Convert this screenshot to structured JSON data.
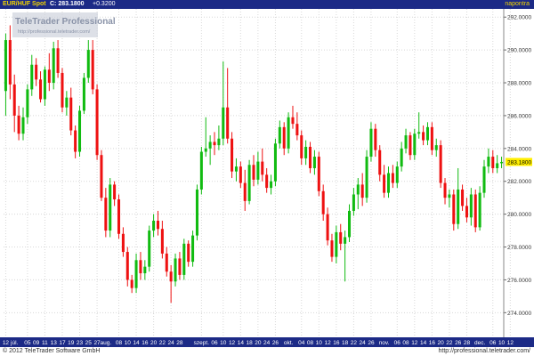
{
  "header": {
    "symbol": "EUR/HUF Spot",
    "close_label": "C: 283.1800",
    "change_label": "+0.3200",
    "period_label": "napontra"
  },
  "watermark": {
    "brand": "TeleTrader Professional",
    "url": "http://professional.teletrader.com/"
  },
  "footer": {
    "copyright": "© 2012 TeleTrader Software GmbH",
    "url": "http://professional.teletrader.com/"
  },
  "colors": {
    "up": "#11bb11",
    "down": "#ee1111",
    "header_bg": "#1c2a86",
    "accent": "#f2d400",
    "grid": "#d8d8d8",
    "last_price_bg": "#ffee00"
  },
  "chart_data": {
    "type": "candlestick",
    "ylim": [
      272.5,
      292.5
    ],
    "yticks": [
      274,
      276,
      278,
      280,
      282,
      284,
      286,
      288,
      290,
      292
    ],
    "ytick_labels": [
      "274.0000",
      "276.0000",
      "278.0000",
      "280.0000",
      "282.0000",
      "284.0000",
      "286.0000",
      "288.0000",
      "290.0000",
      "292.0000"
    ],
    "last_price": 283.18,
    "last_price_label": "283.1800",
    "grid": true,
    "x_labels": [
      {
        "text": "12",
        "index": 0
      },
      {
        "text": "júl.",
        "index": 2
      },
      {
        "text": "05",
        "index": 5
      },
      {
        "text": "09",
        "index": 7
      },
      {
        "text": "11",
        "index": 9
      },
      {
        "text": "13",
        "index": 11
      },
      {
        "text": "17",
        "index": 13
      },
      {
        "text": "19",
        "index": 15
      },
      {
        "text": "23",
        "index": 17
      },
      {
        "text": "25",
        "index": 19
      },
      {
        "text": "27",
        "index": 21
      },
      {
        "text": "aug.",
        "index": 23
      },
      {
        "text": "08",
        "index": 26
      },
      {
        "text": "10",
        "index": 28
      },
      {
        "text": "14",
        "index": 30
      },
      {
        "text": "16",
        "index": 32
      },
      {
        "text": "20",
        "index": 34
      },
      {
        "text": "22",
        "index": 36
      },
      {
        "text": "24",
        "index": 38
      },
      {
        "text": "28",
        "index": 40
      },
      {
        "text": "szept.",
        "index": 45
      },
      {
        "text": "06",
        "index": 48
      },
      {
        "text": "10",
        "index": 50
      },
      {
        "text": "12",
        "index": 52
      },
      {
        "text": "14",
        "index": 54
      },
      {
        "text": "18",
        "index": 56
      },
      {
        "text": "20",
        "index": 58
      },
      {
        "text": "24",
        "index": 60
      },
      {
        "text": "26",
        "index": 62
      },
      {
        "text": "okt.",
        "index": 65
      },
      {
        "text": "04",
        "index": 68
      },
      {
        "text": "08",
        "index": 70
      },
      {
        "text": "10",
        "index": 72
      },
      {
        "text": "12",
        "index": 74
      },
      {
        "text": "16",
        "index": 76
      },
      {
        "text": "18",
        "index": 78
      },
      {
        "text": "22",
        "index": 80
      },
      {
        "text": "24",
        "index": 82
      },
      {
        "text": "26",
        "index": 84
      },
      {
        "text": "nov.",
        "index": 87
      },
      {
        "text": "06",
        "index": 90
      },
      {
        "text": "08",
        "index": 92
      },
      {
        "text": "12",
        "index": 94
      },
      {
        "text": "14",
        "index": 96
      },
      {
        "text": "16",
        "index": 98
      },
      {
        "text": "20",
        "index": 100
      },
      {
        "text": "22",
        "index": 102
      },
      {
        "text": "26",
        "index": 104
      },
      {
        "text": "28",
        "index": 106
      },
      {
        "text": "dec.",
        "index": 109
      },
      {
        "text": "06",
        "index": 112
      },
      {
        "text": "10",
        "index": 114
      },
      {
        "text": "12",
        "index": 116
      }
    ],
    "candles": [
      {
        "o": 287.5,
        "h": 291.0,
        "l": 286.0,
        "c": 290.6
      },
      {
        "o": 290.6,
        "h": 291.5,
        "l": 287.0,
        "c": 287.9
      },
      {
        "o": 287.9,
        "h": 288.5,
        "l": 285.0,
        "c": 286.0
      },
      {
        "o": 286.0,
        "h": 286.6,
        "l": 284.5,
        "c": 284.9
      },
      {
        "o": 284.9,
        "h": 286.5,
        "l": 284.5,
        "c": 285.9
      },
      {
        "o": 285.9,
        "h": 287.9,
        "l": 285.5,
        "c": 287.6
      },
      {
        "o": 287.6,
        "h": 289.7,
        "l": 287.2,
        "c": 289.1
      },
      {
        "o": 289.1,
        "h": 289.5,
        "l": 287.8,
        "c": 288.2
      },
      {
        "o": 288.2,
        "h": 288.7,
        "l": 286.8,
        "c": 287.0
      },
      {
        "o": 287.0,
        "h": 289.0,
        "l": 286.6,
        "c": 288.8
      },
      {
        "o": 288.8,
        "h": 289.8,
        "l": 287.5,
        "c": 288.0
      },
      {
        "o": 288.0,
        "h": 290.5,
        "l": 287.6,
        "c": 290.1
      },
      {
        "o": 290.1,
        "h": 290.6,
        "l": 288.3,
        "c": 288.6
      },
      {
        "o": 288.6,
        "h": 288.9,
        "l": 286.2,
        "c": 286.5
      },
      {
        "o": 286.5,
        "h": 287.5,
        "l": 286.0,
        "c": 287.1
      },
      {
        "o": 287.1,
        "h": 287.7,
        "l": 284.8,
        "c": 285.1
      },
      {
        "o": 285.1,
        "h": 285.4,
        "l": 283.4,
        "c": 283.8
      },
      {
        "o": 283.8,
        "h": 286.6,
        "l": 283.5,
        "c": 286.3
      },
      {
        "o": 286.3,
        "h": 288.6,
        "l": 286.1,
        "c": 288.3
      },
      {
        "o": 288.3,
        "h": 290.6,
        "l": 288.0,
        "c": 290.0
      },
      {
        "o": 290.0,
        "h": 290.6,
        "l": 287.3,
        "c": 287.6
      },
      {
        "o": 287.6,
        "h": 287.9,
        "l": 283.3,
        "c": 283.6
      },
      {
        "o": 283.6,
        "h": 283.9,
        "l": 280.8,
        "c": 281.0
      },
      {
        "o": 281.0,
        "h": 281.6,
        "l": 278.6,
        "c": 279.0
      },
      {
        "o": 279.0,
        "h": 282.2,
        "l": 278.6,
        "c": 281.8
      },
      {
        "o": 281.8,
        "h": 282.0,
        "l": 280.5,
        "c": 280.9
      },
      {
        "o": 280.9,
        "h": 281.2,
        "l": 278.5,
        "c": 278.8
      },
      {
        "o": 278.8,
        "h": 279.2,
        "l": 277.4,
        "c": 277.7
      },
      {
        "o": 277.7,
        "h": 278.0,
        "l": 275.6,
        "c": 276.0
      },
      {
        "o": 276.0,
        "h": 276.3,
        "l": 275.2,
        "c": 275.5
      },
      {
        "o": 275.5,
        "h": 277.6,
        "l": 275.2,
        "c": 277.2
      },
      {
        "o": 277.2,
        "h": 277.7,
        "l": 276.0,
        "c": 276.4
      },
      {
        "o": 276.4,
        "h": 277.2,
        "l": 276.0,
        "c": 276.8
      },
      {
        "o": 276.8,
        "h": 279.3,
        "l": 276.5,
        "c": 279.0
      },
      {
        "o": 279.0,
        "h": 280.0,
        "l": 278.6,
        "c": 279.6
      },
      {
        "o": 279.6,
        "h": 280.2,
        "l": 278.7,
        "c": 279.1
      },
      {
        "o": 279.1,
        "h": 279.6,
        "l": 277.3,
        "c": 277.6
      },
      {
        "o": 277.6,
        "h": 278.0,
        "l": 276.2,
        "c": 276.5
      },
      {
        "o": 276.5,
        "h": 276.9,
        "l": 274.6,
        "c": 275.9
      },
      {
        "o": 275.9,
        "h": 277.6,
        "l": 275.6,
        "c": 277.3
      },
      {
        "o": 277.3,
        "h": 277.7,
        "l": 276.0,
        "c": 276.3
      },
      {
        "o": 276.3,
        "h": 278.5,
        "l": 276.0,
        "c": 278.2
      },
      {
        "o": 278.2,
        "h": 278.4,
        "l": 276.8,
        "c": 277.1
      },
      {
        "o": 277.1,
        "h": 279.0,
        "l": 276.8,
        "c": 278.7
      },
      {
        "o": 278.7,
        "h": 281.8,
        "l": 278.4,
        "c": 281.5
      },
      {
        "o": 281.5,
        "h": 284.1,
        "l": 281.2,
        "c": 283.8
      },
      {
        "o": 283.8,
        "h": 285.9,
        "l": 283.5,
        "c": 284.0
      },
      {
        "o": 284.0,
        "h": 284.8,
        "l": 283.0,
        "c": 284.4
      },
      {
        "o": 284.4,
        "h": 285.0,
        "l": 283.6,
        "c": 284.2
      },
      {
        "o": 284.2,
        "h": 285.4,
        "l": 283.9,
        "c": 284.6
      },
      {
        "o": 284.6,
        "h": 289.3,
        "l": 284.2,
        "c": 286.5
      },
      {
        "o": 286.5,
        "h": 288.9,
        "l": 284.3,
        "c": 284.6
      },
      {
        "o": 284.6,
        "h": 285.0,
        "l": 282.2,
        "c": 282.6
      },
      {
        "o": 282.6,
        "h": 283.4,
        "l": 282.0,
        "c": 282.9
      },
      {
        "o": 282.9,
        "h": 283.2,
        "l": 281.6,
        "c": 281.9
      },
      {
        "o": 281.9,
        "h": 282.7,
        "l": 280.2,
        "c": 280.8
      },
      {
        "o": 280.8,
        "h": 283.3,
        "l": 280.6,
        "c": 283.0
      },
      {
        "o": 283.0,
        "h": 283.6,
        "l": 281.7,
        "c": 282.1
      },
      {
        "o": 282.1,
        "h": 283.8,
        "l": 281.8,
        "c": 283.2
      },
      {
        "o": 283.2,
        "h": 284.0,
        "l": 282.0,
        "c": 282.4
      },
      {
        "o": 282.4,
        "h": 282.8,
        "l": 281.3,
        "c": 281.6
      },
      {
        "o": 281.6,
        "h": 282.4,
        "l": 281.2,
        "c": 282.0
      },
      {
        "o": 282.0,
        "h": 284.6,
        "l": 281.7,
        "c": 284.3
      },
      {
        "o": 284.3,
        "h": 285.7,
        "l": 284.0,
        "c": 285.3
      },
      {
        "o": 285.3,
        "h": 285.6,
        "l": 283.6,
        "c": 284.0
      },
      {
        "o": 284.0,
        "h": 286.2,
        "l": 283.7,
        "c": 285.9
      },
      {
        "o": 285.9,
        "h": 286.6,
        "l": 285.2,
        "c": 285.5
      },
      {
        "o": 285.5,
        "h": 286.2,
        "l": 284.5,
        "c": 284.8
      },
      {
        "o": 284.8,
        "h": 285.1,
        "l": 283.0,
        "c": 283.4
      },
      {
        "o": 283.4,
        "h": 284.5,
        "l": 283.0,
        "c": 284.1
      },
      {
        "o": 284.1,
        "h": 284.4,
        "l": 282.5,
        "c": 282.8
      },
      {
        "o": 282.8,
        "h": 283.9,
        "l": 282.4,
        "c": 283.5
      },
      {
        "o": 283.5,
        "h": 283.8,
        "l": 281.1,
        "c": 281.4
      },
      {
        "o": 281.4,
        "h": 281.8,
        "l": 279.6,
        "c": 280.0
      },
      {
        "o": 280.0,
        "h": 280.4,
        "l": 278.1,
        "c": 278.4
      },
      {
        "o": 278.4,
        "h": 278.8,
        "l": 277.1,
        "c": 277.4
      },
      {
        "o": 277.4,
        "h": 279.3,
        "l": 277.0,
        "c": 278.9
      },
      {
        "o": 278.9,
        "h": 279.4,
        "l": 277.8,
        "c": 278.2
      },
      {
        "o": 278.2,
        "h": 279.0,
        "l": 275.9,
        "c": 278.6
      },
      {
        "o": 278.6,
        "h": 280.6,
        "l": 278.3,
        "c": 280.2
      },
      {
        "o": 280.2,
        "h": 281.6,
        "l": 279.9,
        "c": 281.2
      },
      {
        "o": 281.2,
        "h": 282.2,
        "l": 280.3,
        "c": 281.8
      },
      {
        "o": 281.8,
        "h": 282.5,
        "l": 280.5,
        "c": 281.0
      },
      {
        "o": 281.0,
        "h": 283.9,
        "l": 280.7,
        "c": 283.5
      },
      {
        "o": 283.5,
        "h": 285.6,
        "l": 283.2,
        "c": 285.2
      },
      {
        "o": 285.2,
        "h": 285.5,
        "l": 283.5,
        "c": 283.9
      },
      {
        "o": 283.9,
        "h": 284.2,
        "l": 282.0,
        "c": 282.4
      },
      {
        "o": 282.4,
        "h": 283.0,
        "l": 281.0,
        "c": 281.3
      },
      {
        "o": 281.3,
        "h": 282.9,
        "l": 281.0,
        "c": 282.5
      },
      {
        "o": 282.5,
        "h": 283.0,
        "l": 281.6,
        "c": 281.9
      },
      {
        "o": 281.9,
        "h": 283.2,
        "l": 281.6,
        "c": 282.9
      },
      {
        "o": 282.9,
        "h": 284.4,
        "l": 282.6,
        "c": 284.0
      },
      {
        "o": 284.0,
        "h": 285.2,
        "l": 283.7,
        "c": 284.8
      },
      {
        "o": 284.8,
        "h": 285.0,
        "l": 283.3,
        "c": 283.6
      },
      {
        "o": 283.6,
        "h": 285.2,
        "l": 283.3,
        "c": 284.9
      },
      {
        "o": 284.9,
        "h": 286.2,
        "l": 284.6,
        "c": 285.0
      },
      {
        "o": 285.0,
        "h": 285.4,
        "l": 284.2,
        "c": 284.5
      },
      {
        "o": 284.5,
        "h": 285.6,
        "l": 284.2,
        "c": 285.3
      },
      {
        "o": 285.3,
        "h": 285.6,
        "l": 283.6,
        "c": 283.9
      },
      {
        "o": 283.9,
        "h": 284.6,
        "l": 283.5,
        "c": 284.2
      },
      {
        "o": 284.2,
        "h": 284.5,
        "l": 281.6,
        "c": 281.9
      },
      {
        "o": 281.9,
        "h": 282.2,
        "l": 280.6,
        "c": 281.0
      },
      {
        "o": 281.0,
        "h": 281.5,
        "l": 280.4,
        "c": 281.2
      },
      {
        "o": 281.2,
        "h": 281.5,
        "l": 279.0,
        "c": 279.4
      },
      {
        "o": 279.4,
        "h": 282.8,
        "l": 279.1,
        "c": 281.5
      },
      {
        "o": 281.5,
        "h": 281.8,
        "l": 280.2,
        "c": 280.5
      },
      {
        "o": 280.5,
        "h": 281.0,
        "l": 279.5,
        "c": 279.8
      },
      {
        "o": 279.8,
        "h": 281.6,
        "l": 279.3,
        "c": 281.2
      },
      {
        "o": 281.2,
        "h": 281.5,
        "l": 278.9,
        "c": 279.2
      },
      {
        "o": 279.2,
        "h": 281.7,
        "l": 279.0,
        "c": 281.3
      },
      {
        "o": 281.3,
        "h": 283.3,
        "l": 281.0,
        "c": 282.9
      },
      {
        "o": 282.9,
        "h": 284.0,
        "l": 282.5,
        "c": 283.5
      },
      {
        "o": 283.5,
        "h": 283.9,
        "l": 282.5,
        "c": 282.8
      },
      {
        "o": 282.8,
        "h": 283.6,
        "l": 282.5,
        "c": 283.1
      },
      {
        "o": 283.1,
        "h": 283.5,
        "l": 282.8,
        "c": 283.18
      }
    ]
  }
}
